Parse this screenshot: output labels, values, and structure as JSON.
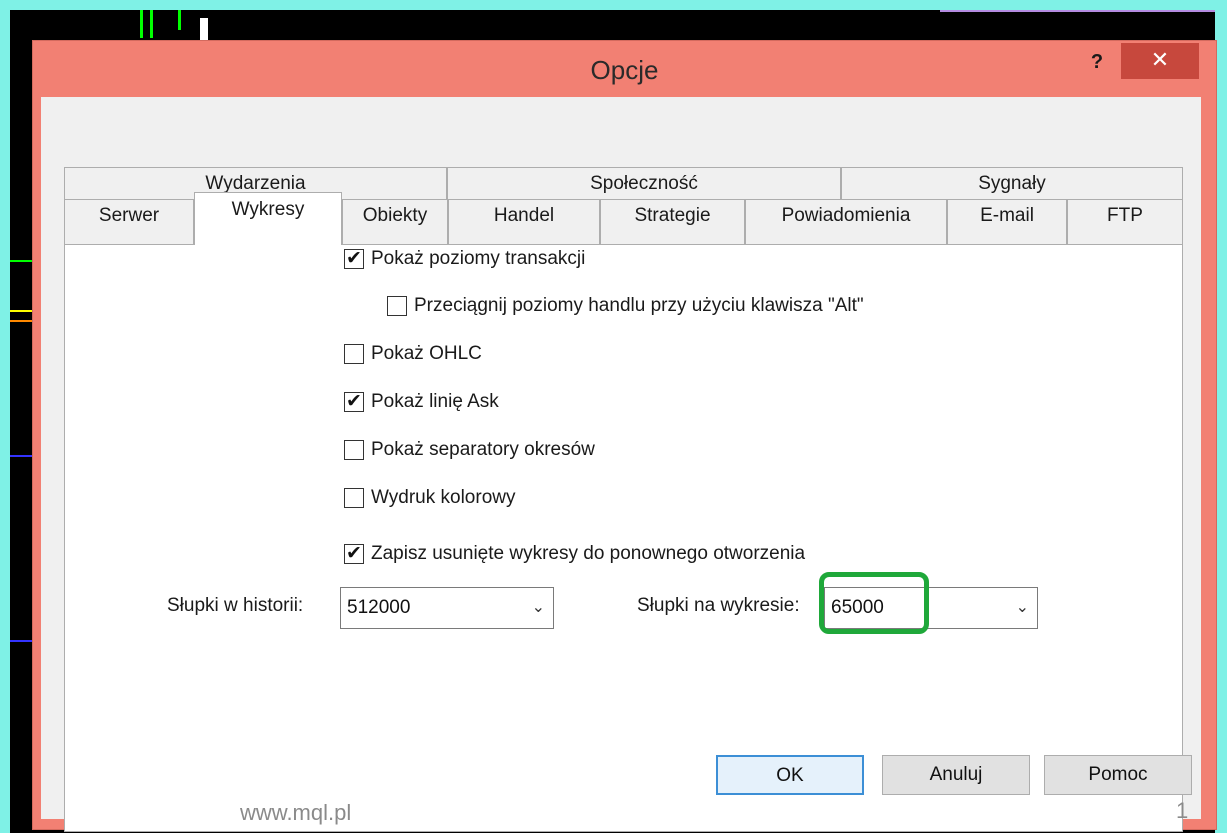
{
  "window": {
    "title": "Opcje",
    "help_label": "?",
    "close_label": "✕"
  },
  "tabs_top": [
    {
      "label": "Wydarzenia"
    },
    {
      "label": "Społeczność"
    },
    {
      "label": "Sygnały"
    }
  ],
  "tabs_bottom": [
    {
      "label": "Serwer"
    },
    {
      "label": "Wykresy",
      "active": true
    },
    {
      "label": "Obiekty"
    },
    {
      "label": "Handel"
    },
    {
      "label": "Strategie"
    },
    {
      "label": "Powiadomienia"
    },
    {
      "label": "E-mail"
    },
    {
      "label": "FTP"
    }
  ],
  "options": [
    {
      "label": "Pokaż poziomy transakcji",
      "checked": true
    },
    {
      "label": "Przeciągnij poziomy handlu przy użyciu klawisza \"Alt\"",
      "checked": false
    },
    {
      "label": "Pokaż OHLC",
      "checked": false
    },
    {
      "label": "Pokaż linię Ask",
      "checked": true
    },
    {
      "label": "Pokaż separatory okresów",
      "checked": false
    },
    {
      "label": "Wydruk kolorowy",
      "checked": false
    },
    {
      "label": "Zapisz usunięte wykresy do ponownego otworzenia",
      "checked": true
    }
  ],
  "history_bars": {
    "label": "Słupki w historii:",
    "value": "512000"
  },
  "chart_bars": {
    "label": "Słupki na wykresie:",
    "value": "65000"
  },
  "buttons": {
    "ok": "OK",
    "cancel": "Anuluj",
    "help": "Pomoc"
  },
  "footer": {
    "url": "www.mql.pl",
    "page": "1"
  },
  "colors": {
    "highlight": "#1fa83a",
    "titlebar": "#f28073",
    "close": "#c7483d"
  }
}
